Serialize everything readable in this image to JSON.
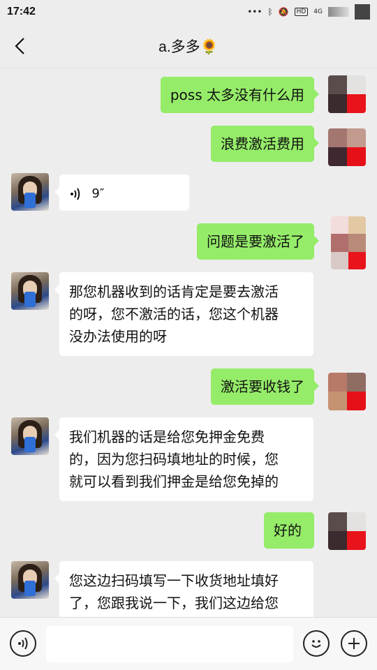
{
  "status_bar": {
    "time": "17:42",
    "signal_label": "4G"
  },
  "navbar": {
    "title": "a.多多🌻"
  },
  "messages": [
    {
      "side": "right",
      "text": "poss 太多没有什么用"
    },
    {
      "side": "right",
      "text": "浪费激活费用"
    },
    {
      "side": "left",
      "type": "voice",
      "duration": "9″"
    },
    {
      "side": "right",
      "text": "问题是要激活了"
    },
    {
      "side": "left",
      "lines": [
        "那您机器收到的话肯定是要去激活",
        "的呀，您不激活的话，您这个机器",
        "没办法使用的呀"
      ]
    },
    {
      "side": "right",
      "text": "激活要收钱了"
    },
    {
      "side": "left",
      "lines": [
        "我们机器的话是给您免押金免费",
        "的，因为您扫码填地址的时候，您",
        "就可以看到我们押金是给您免掉的"
      ]
    },
    {
      "side": "right",
      "text": "好的"
    },
    {
      "side": "left",
      "lines": [
        "您这边扫码填写一下收货地址填好",
        "了，您跟我说一下，我们这边给您"
      ]
    }
  ],
  "input_bar": {
    "placeholder": ""
  },
  "colors": {
    "green_bubble": "#95ec69",
    "white_bubble": "#ffffff",
    "background": "#ededed"
  },
  "icons": [
    "back-chevron-icon",
    "voice-wave-icon",
    "voice-mode-icon",
    "emoji-icon",
    "plus-icon"
  ]
}
